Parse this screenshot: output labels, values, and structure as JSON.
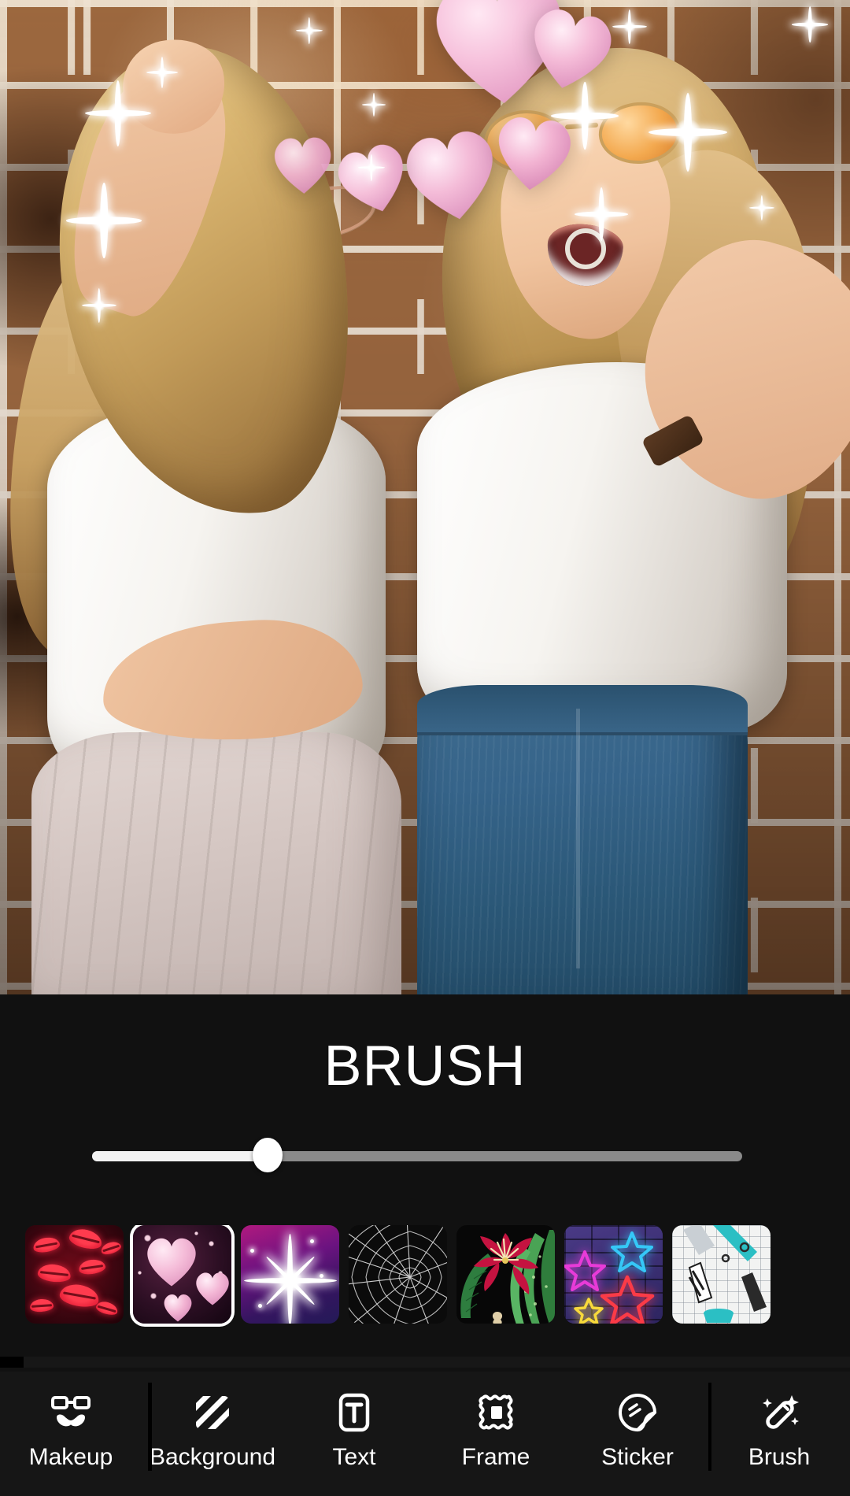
{
  "app": {
    "panel_background": "#111111",
    "nav_background": "#161616",
    "accent": "#ffffff"
  },
  "photo": {
    "name": "photo-canvas",
    "description": "Two young women laughing in front of a brick wall",
    "stickers": {
      "hearts_label": "pink-heart-sticker",
      "sparkles_label": "white-sparkle-sticker",
      "heart_color": "#f3b7d2",
      "sparkle_color": "#ffffff"
    }
  },
  "panel": {
    "title": "BRUSH",
    "slider": {
      "name": "brush-size-slider",
      "value": 27,
      "min": 0,
      "max": 100,
      "track_color": "#8a8a8a",
      "fill_color": "#f2f2f2",
      "thumb_color": "#ffffff"
    }
  },
  "thumbnails": {
    "selected_index": 1,
    "items": [
      {
        "name": "thumb-lips",
        "label": "Lips",
        "style": "lips"
      },
      {
        "name": "thumb-hearts",
        "label": "Hearts",
        "style": "hearts"
      },
      {
        "name": "thumb-sparkle",
        "label": "Sparkle",
        "style": "star"
      },
      {
        "name": "thumb-spiderweb",
        "label": "Spider Web",
        "style": "web"
      },
      {
        "name": "thumb-flower",
        "label": "Flower",
        "style": "flower"
      },
      {
        "name": "thumb-neon-stars",
        "label": "Neon Stars",
        "style": "neon"
      },
      {
        "name": "thumb-school",
        "label": "School",
        "style": "school"
      }
    ]
  },
  "bottom_nav": {
    "active": "Brush",
    "items": [
      {
        "label": "Makeup",
        "icon": "glasses-mustache-icon"
      },
      {
        "label": "Background",
        "icon": "diagonal-stripes-icon"
      },
      {
        "label": "Text",
        "icon": "text-box-icon"
      },
      {
        "label": "Frame",
        "icon": "frame-icon"
      },
      {
        "label": "Sticker",
        "icon": "sticker-peel-icon"
      },
      {
        "label": "Brush",
        "icon": "magic-wand-icon"
      }
    ]
  }
}
